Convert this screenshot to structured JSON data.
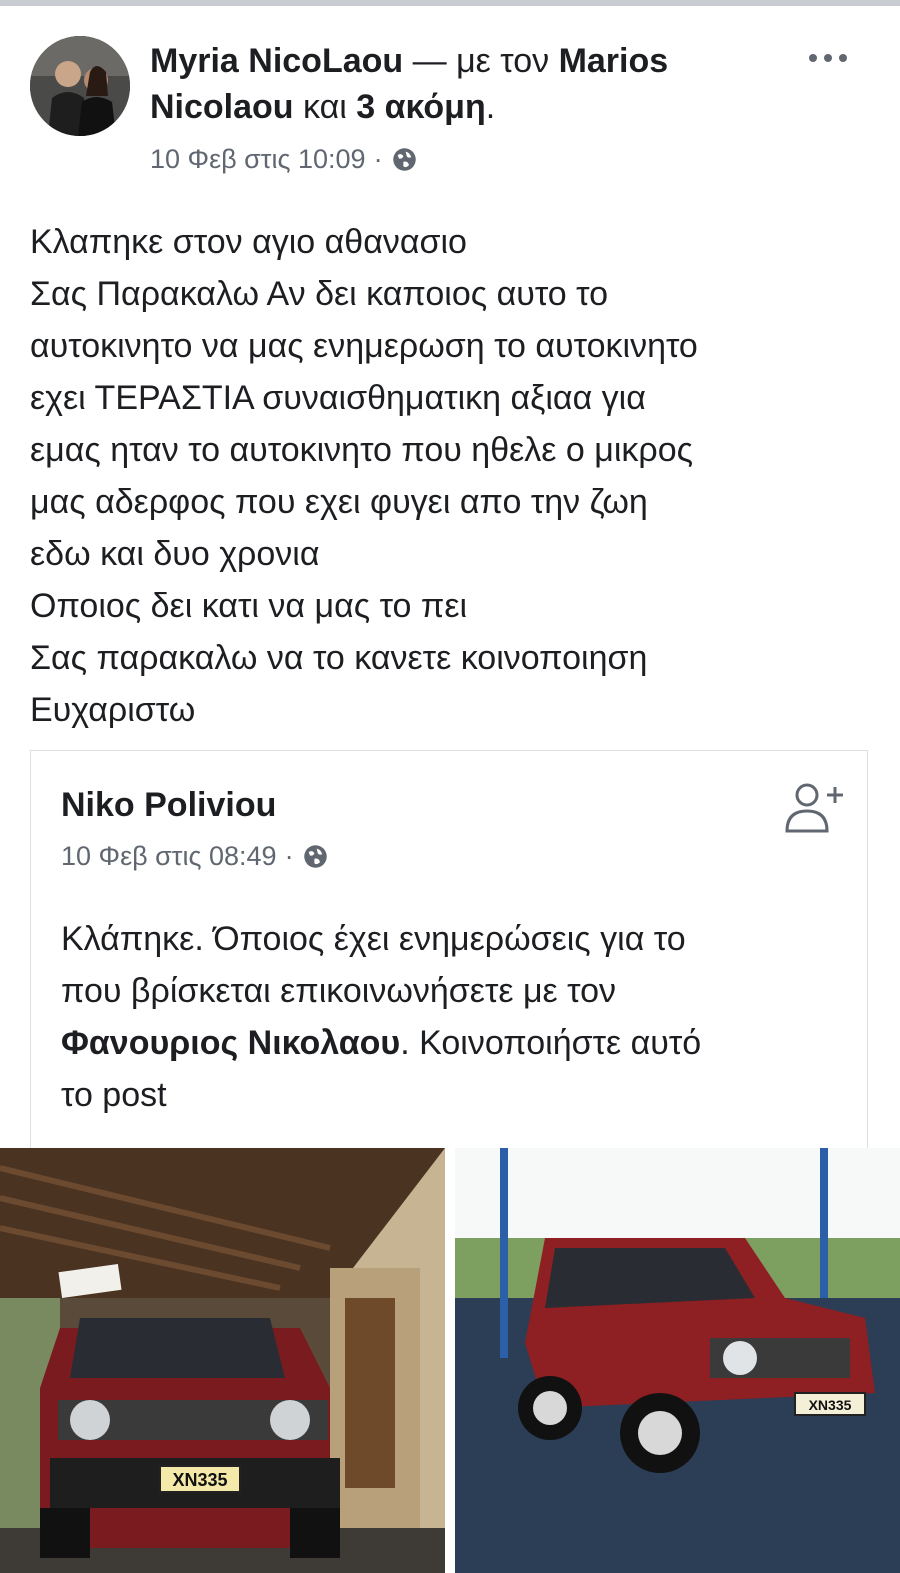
{
  "post": {
    "author": "Myria NicoLaou",
    "with_sep": "— με τον",
    "tagged": "Marios Nicolaou",
    "and_text": "και",
    "others": "3 ακόμη",
    "period": ".",
    "timestamp": "10 Φεβ στις 10:09",
    "dot": "·",
    "privacy_icon": "globe-icon",
    "more_icon": "more-options-icon",
    "lines": [
      "Κλαπηκε στον αγιο αθανασιο",
      "Σας Παρακαλω Αν δει καποιος αυτο το",
      "αυτοκινητο να μας ενημερωση το αυτοκινητο",
      "εχει ΤΕΡΑΣΤΙΑ συναισθηματικη αξιαα για",
      "εμας ηταν το αυτοκινητο που ηθελε ο μικρος",
      "μας αδερφος που εχει φυγει απο την ζωη",
      "εδω και δυο χρονια",
      "Οποιος δει κατι να μας το πει",
      "Σας παρακαλω να το κανετε κοινοποιηση",
      "Ευχαριστω"
    ]
  },
  "shared": {
    "author": "Niko Poliviou",
    "timestamp": "10 Φεβ στις 08:49",
    "dot": "·",
    "add_friend_icon": "add-friend-icon",
    "line1": "Κλάπηκε. Όποιος έχει ενημερώσεις για το",
    "line2": "που βρίσκεται επικοινωνήσετε με τον",
    "line3_bold": "Φανουριος Νικολαου",
    "line3_rest": ". Κοινοποιήστε αυτό",
    "line4": "το post",
    "photos": [
      {
        "plate": "XN335"
      },
      {
        "plate": "XN335"
      }
    ]
  },
  "colors": {
    "text": "#1c1e21",
    "meta": "#606770",
    "border": "#dddfe2",
    "car_red": "#8e1f22"
  }
}
